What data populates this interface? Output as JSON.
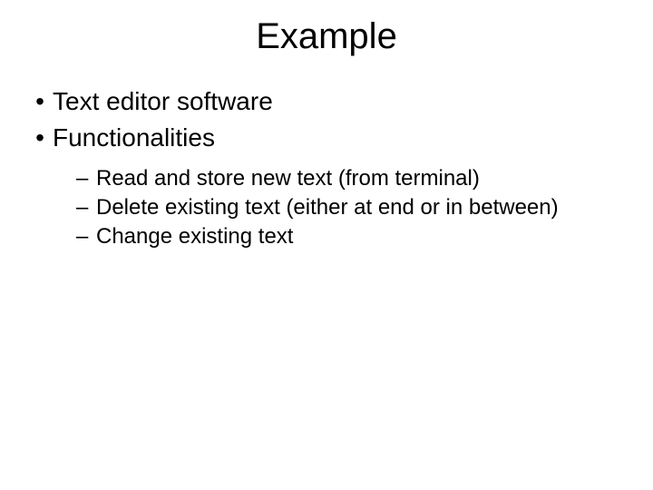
{
  "title": "Example",
  "bullets": {
    "b1": "Text editor software",
    "b2": "Functionalities"
  },
  "subbullets": {
    "s1": "Read and store new text (from terminal)",
    "s2": "Delete existing text (either at end or in between)",
    "s3": "Change existing text"
  },
  "markers": {
    "dot": "•",
    "dash": "–"
  }
}
